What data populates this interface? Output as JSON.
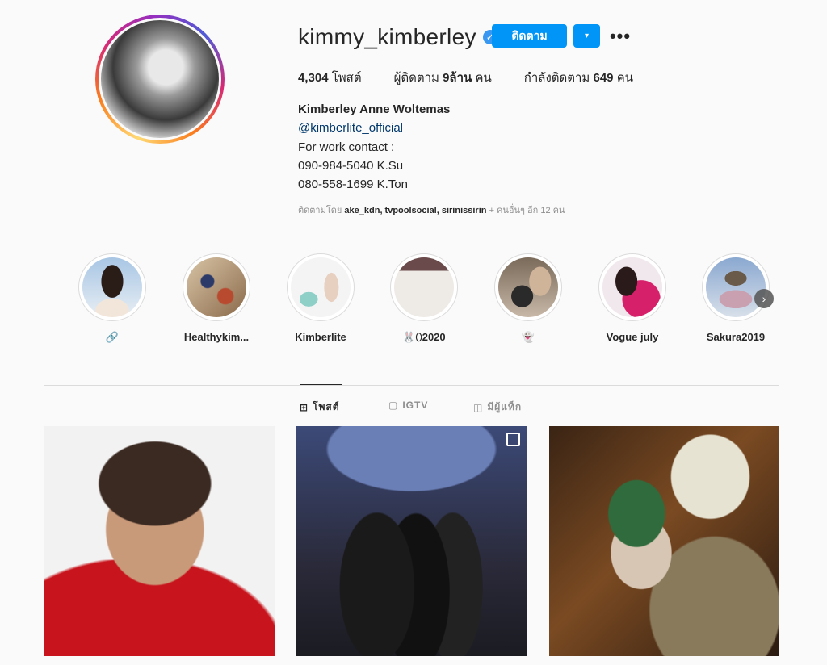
{
  "profile": {
    "username": "kimmy_kimberley",
    "verified_symbol": "✓",
    "follow_label": "ติดตาม",
    "dropdown_symbol": "▾",
    "more_symbol": "•••",
    "stats": {
      "posts_count": "4,304",
      "posts_label": "โพสต์",
      "followers_prefix": "ผู้ติดตาม",
      "followers_count": "9ล้าน",
      "followers_suffix": "คน",
      "following_prefix": "กำลังติดตาม",
      "following_count": "649",
      "following_suffix": "คน"
    },
    "bio": {
      "full_name": "Kimberley Anne Woltemas",
      "link": "@kimberlite_official",
      "line1": "For work contact :",
      "line2": "090-984-5040 K.Su",
      "line3": "080-558-1699 K.Ton"
    },
    "followed_by": {
      "prefix": "ติดตามโดย",
      "names": "ake_kdn, tvpoolsocial, sirinissirin",
      "suffix": "+ คนอื่นๆ อีก 12 คน"
    }
  },
  "highlights": [
    {
      "label": "🔗"
    },
    {
      "label": "Healthykim..."
    },
    {
      "label": "Kimberlite"
    },
    {
      "label": "🐰⬯2020"
    },
    {
      "label": "👻"
    },
    {
      "label": "Vogue july"
    },
    {
      "label": "Sakura2019"
    }
  ],
  "highlights_next_symbol": "›",
  "tabs": [
    {
      "icon": "⊞",
      "label": "โพสต์"
    },
    {
      "icon": "▢",
      "label": "IGTV"
    },
    {
      "icon": "◫",
      "label": "มีผู้แท็ก"
    }
  ],
  "colors": {
    "accent": "#0095f6",
    "verified": "#3897f0",
    "link": "#00376b"
  }
}
